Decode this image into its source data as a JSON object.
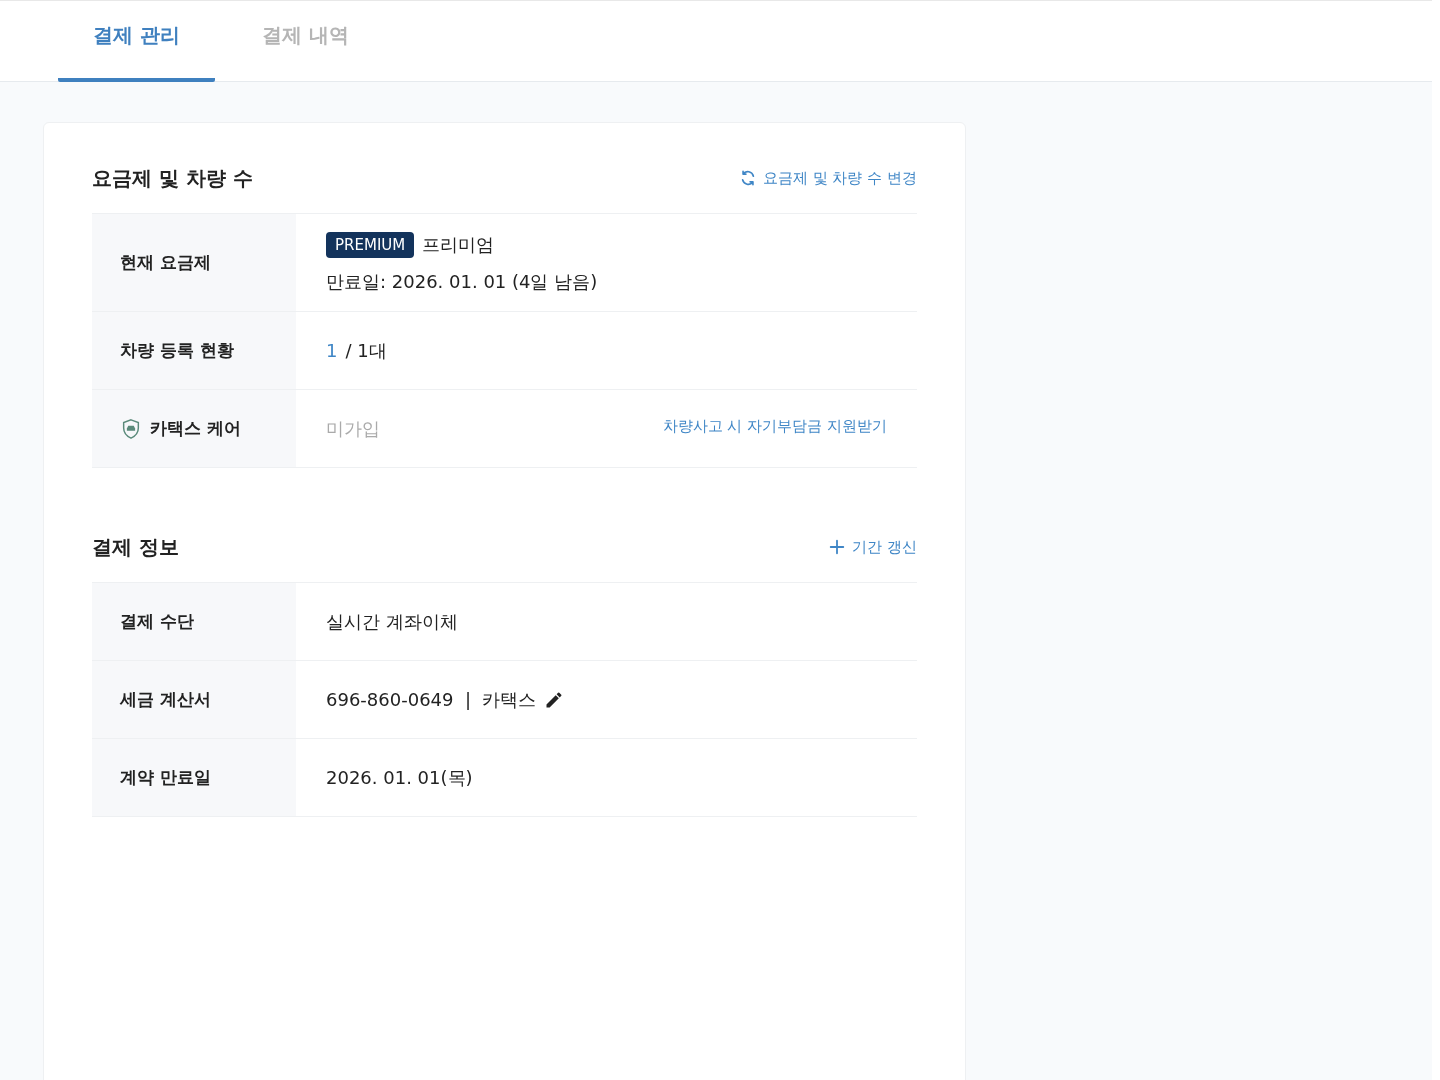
{
  "tabs": [
    {
      "label": "결제 관리",
      "selected": true
    },
    {
      "label": "결제 내역",
      "selected": false
    }
  ],
  "sections": [
    {
      "title": "요금제 및 차량 수",
      "action": {
        "kind": "refresh",
        "label": "요금제 및 차량 수 변경"
      },
      "rows": [
        {
          "kind": "plan",
          "label": "현재 요금제",
          "badge": "PREMIUM",
          "plan_name": "프리미엄",
          "expiry": "만료일: 2026. 01. 01 (4일 남음)"
        },
        {
          "kind": "count",
          "label": "차량 등록 현황",
          "current": "1",
          "total": "/ 1대"
        },
        {
          "kind": "care",
          "label": "카택스 케어",
          "value": "미가입",
          "link": "차량사고 시 자기부담금 지원받기"
        }
      ]
    },
    {
      "title": "결제 정보",
      "action": {
        "kind": "add",
        "label": "기간 갱신"
      },
      "rows": [
        {
          "kind": "text",
          "label": "결제 수단",
          "value": "실시간 계좌이체"
        },
        {
          "kind": "tax",
          "label": "세금 계산서",
          "value": "696-860-0649  |  카택스"
        },
        {
          "kind": "text",
          "label": "계약 만료일",
          "value": "2026. 01. 01(목)"
        }
      ]
    }
  ]
}
